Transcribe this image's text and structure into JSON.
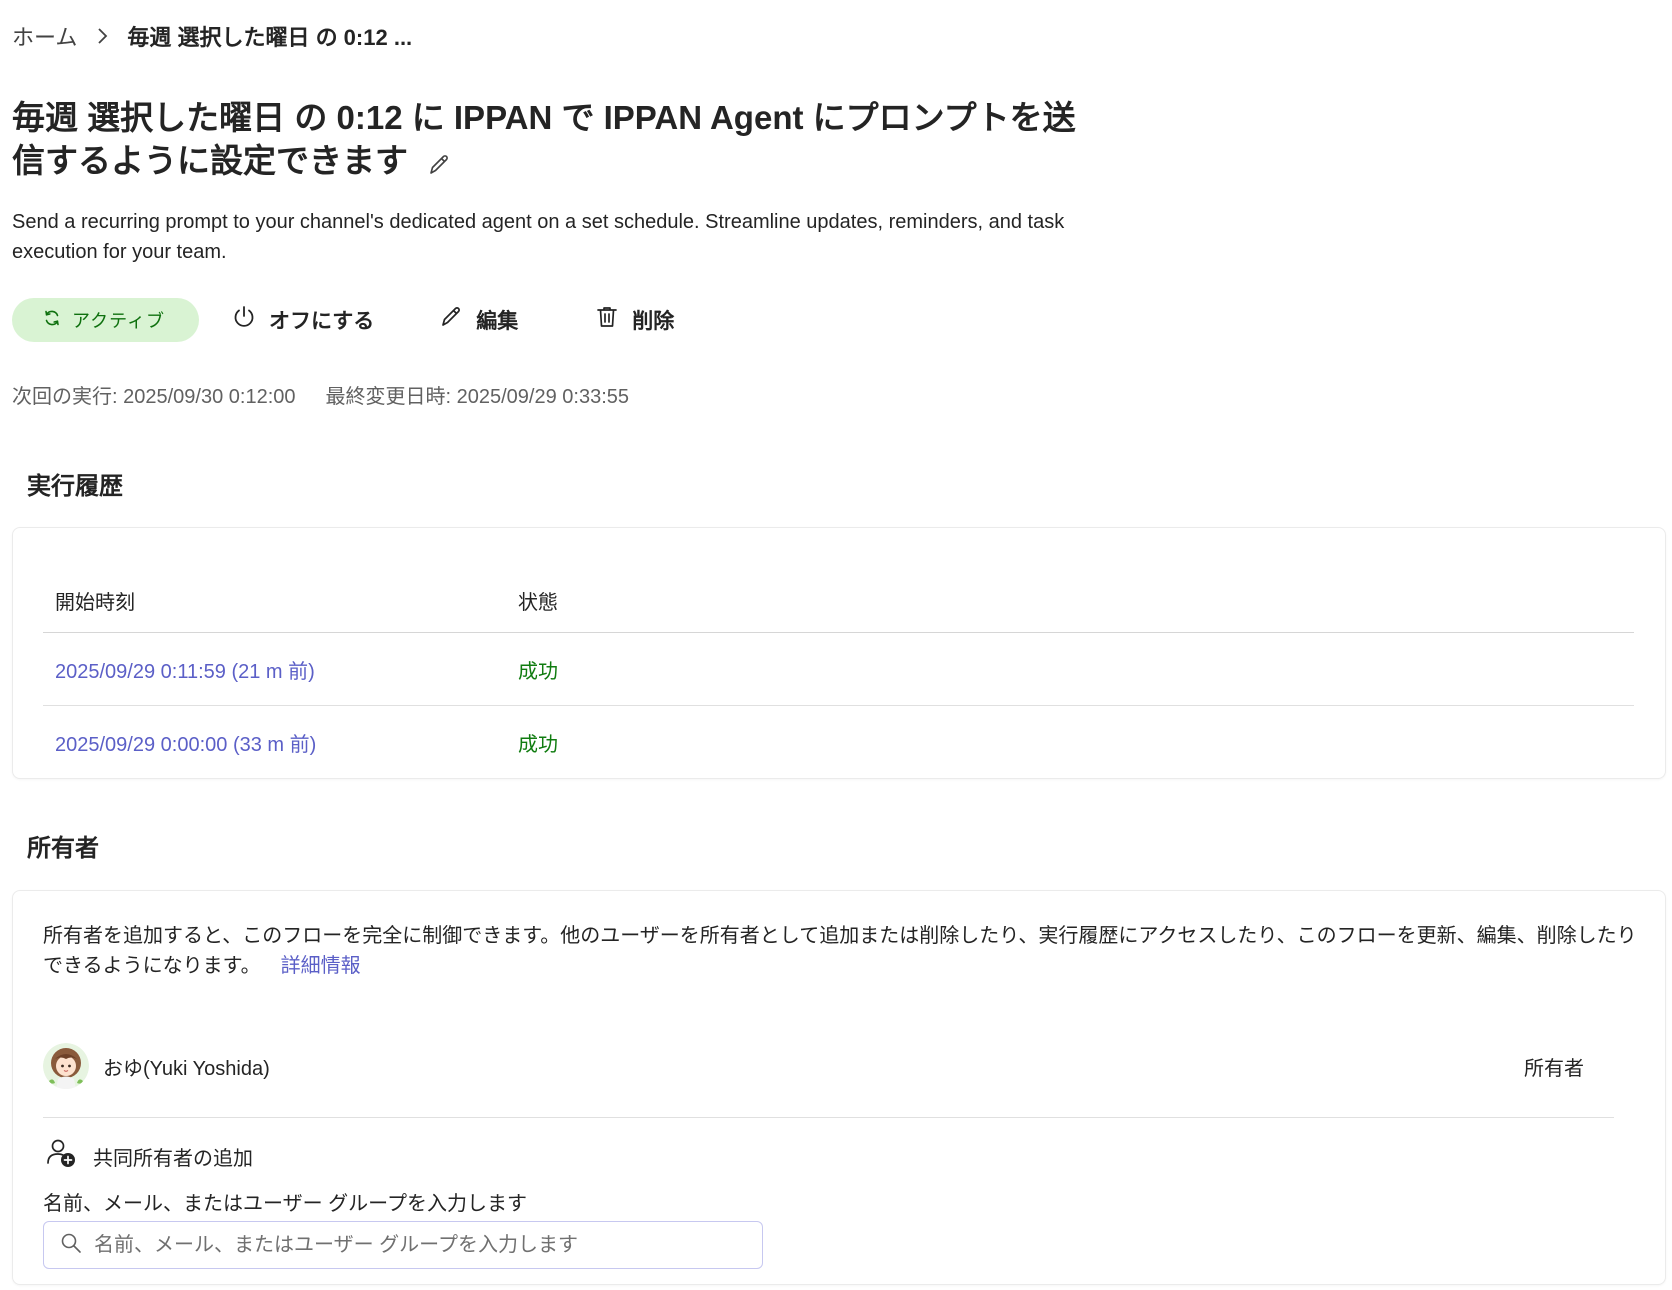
{
  "breadcrumb": {
    "home": "ホーム",
    "current": "毎週 選択した曜日 の 0:12 ..."
  },
  "page": {
    "title": "毎週 選択した曜日 の 0:12 に IPPAN で IPPAN Agent にプロンプトを送信するように設定できます",
    "description": "Send a recurring prompt to your channel's dedicated agent on a set schedule. Streamline updates, reminders, and task execution for your team."
  },
  "actions": {
    "status_label": "アクティブ",
    "turn_off_label": "オフにする",
    "edit_label": "編集",
    "delete_label": "削除"
  },
  "meta": {
    "next_run": "次回の実行: 2025/09/30 0:12:00",
    "last_modified": "最終変更日時: 2025/09/29 0:33:55"
  },
  "history": {
    "heading": "実行履歴",
    "col_start": "開始時刻",
    "col_status": "状態",
    "rows": [
      {
        "start": "2025/09/29 0:11:59 (21 m 前)",
        "status": "成功"
      },
      {
        "start": "2025/09/29 0:00:00 (33 m 前)",
        "status": "成功"
      }
    ]
  },
  "owners": {
    "heading": "所有者",
    "description": "所有者を追加すると、このフローを完全に制御できます。他のユーザーを所有者として追加または削除したり、実行履歴にアクセスしたり、このフローを更新、編集、削除したりできるようになります。",
    "learn_more": "詳細情報",
    "owner_name": "おゆ(Yuki Yoshida)",
    "owner_role": "所有者",
    "add_coowner_label": "共同所有者の追加",
    "field_label": "名前、メール、またはユーザー グループを入力します",
    "search_placeholder": "名前、メール、またはユーザー グループを入力します"
  },
  "colors": {
    "accent": "#5b5fc7",
    "success": "#107c10",
    "active_pill_bg": "#d9f3d3"
  },
  "icons": [
    "chevron-right-icon",
    "pencil-icon",
    "refresh-icon",
    "power-icon",
    "trash-icon",
    "person-add-icon",
    "search-icon"
  ]
}
